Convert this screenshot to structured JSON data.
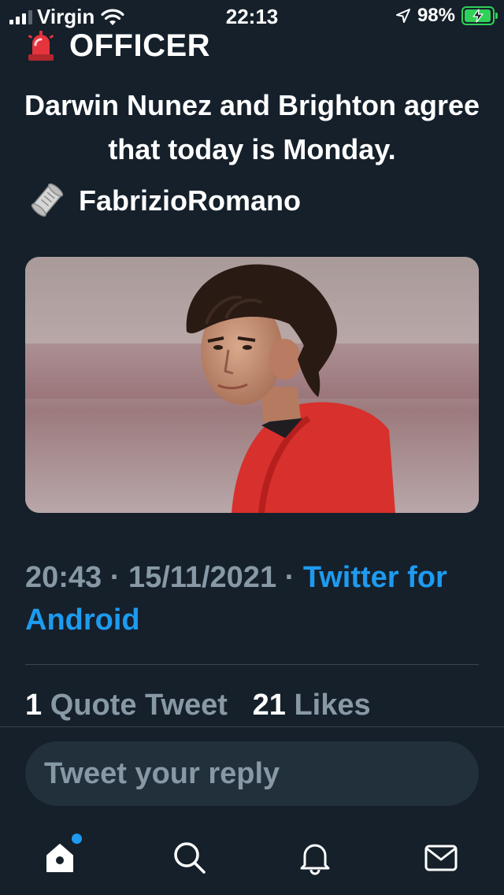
{
  "status_bar": {
    "carrier": "Virgin",
    "time": "22:13",
    "battery_percent": "98%",
    "battery_level": 0.98,
    "signal_bars_active": 3,
    "icons": [
      "signal-icon",
      "wifi-icon",
      "location-arrow-icon",
      "battery-charging-icon"
    ]
  },
  "tweet": {
    "header_emoji": "police-light-icon",
    "header_text": "OFFICER",
    "body": "Darwin Nunez and Brighton agree that today is Monday.",
    "source_emoji": "scroll-icon",
    "source_name": "FabrizioRomano",
    "image_alt": "photo-of-footballer-in-red-kit",
    "time": "20:43",
    "separator": "·",
    "date": "15/11/2021",
    "client_line1": "Twitter",
    "client_line2": "for Android"
  },
  "stats": {
    "quote_count": "1",
    "quote_label": "Quote Tweet",
    "likes_count": "21",
    "likes_label": "Likes"
  },
  "reply": {
    "placeholder": "Tweet your reply"
  },
  "tab_bar": {
    "tabs": [
      "home-icon",
      "search-icon",
      "notifications-icon",
      "messages-icon"
    ],
    "home_has_badge": true
  },
  "colors": {
    "background": "#15202b",
    "accent": "#1d9bf0",
    "muted_text": "#8899a6",
    "divider": "#38444d",
    "battery": "#30d158"
  }
}
